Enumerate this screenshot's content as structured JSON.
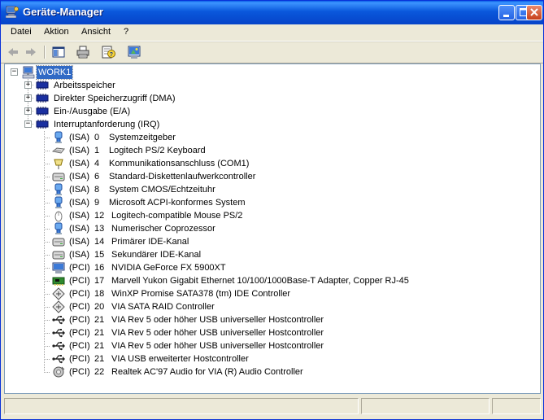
{
  "window": {
    "title": "Geräte-Manager"
  },
  "menu": [
    {
      "label": "Datei"
    },
    {
      "label": "Aktion"
    },
    {
      "label": "Ansicht"
    },
    {
      "label": "?"
    }
  ],
  "toolbar": {
    "back_icon": "back-arrow-icon",
    "forward_icon": "forward-arrow-icon",
    "show_hide_tree_icon": "console-tree-icon",
    "print_icon": "printer-icon",
    "help_icon": "help-properties-icon",
    "scan_icon": "scan-hardware-icon"
  },
  "tree": {
    "root": {
      "label": "WORK1",
      "expanded": true,
      "icon": "computer-icon"
    },
    "categories": [
      {
        "label": "Arbeitsspeicher",
        "expanded": false,
        "icon": "memory-chip-icon"
      },
      {
        "label": "Direkter Speicherzugriff (DMA)",
        "expanded": false,
        "icon": "memory-chip-icon"
      },
      {
        "label": "Ein-/Ausgabe (E/A)",
        "expanded": false,
        "icon": "memory-chip-icon"
      },
      {
        "label": "Interruptanforderung (IRQ)",
        "expanded": true,
        "icon": "memory-chip-icon"
      }
    ],
    "irq_items": [
      {
        "bus": "(ISA)",
        "irq": "0",
        "name": "Systemzeitgeber",
        "icon": "system-device-icon"
      },
      {
        "bus": "(ISA)",
        "irq": "1",
        "name": "Logitech PS/2 Keyboard",
        "icon": "keyboard-icon"
      },
      {
        "bus": "(ISA)",
        "irq": "4",
        "name": "Kommunikationsanschluss (COM1)",
        "icon": "port-icon"
      },
      {
        "bus": "(ISA)",
        "irq": "6",
        "name": "Standard-Diskettenlaufwerkcontroller",
        "icon": "disk-controller-icon"
      },
      {
        "bus": "(ISA)",
        "irq": "8",
        "name": "System CMOS/Echtzeituhr",
        "icon": "system-device-icon"
      },
      {
        "bus": "(ISA)",
        "irq": "9",
        "name": "Microsoft ACPI-konformes System",
        "icon": "system-device-icon"
      },
      {
        "bus": "(ISA)",
        "irq": "12",
        "name": "Logitech-compatible Mouse PS/2",
        "icon": "mouse-icon"
      },
      {
        "bus": "(ISA)",
        "irq": "13",
        "name": "Numerischer Coprozessor",
        "icon": "system-device-icon"
      },
      {
        "bus": "(ISA)",
        "irq": "14",
        "name": "Primärer IDE-Kanal",
        "icon": "disk-controller-icon"
      },
      {
        "bus": "(ISA)",
        "irq": "15",
        "name": "Sekundärer IDE-Kanal",
        "icon": "disk-controller-icon"
      },
      {
        "bus": "(PCI)",
        "irq": "16",
        "name": "NVIDIA GeForce FX 5900XT",
        "icon": "display-adapter-icon"
      },
      {
        "bus": "(PCI)",
        "irq": "17",
        "name": "Marvell Yukon Gigabit Ethernet 10/100/1000Base-T Adapter, Copper RJ-45",
        "icon": "network-adapter-icon"
      },
      {
        "bus": "(PCI)",
        "irq": "18",
        "name": "WinXP Promise SATA378 (tm) IDE Controller",
        "icon": "scsi-raid-icon"
      },
      {
        "bus": "(PCI)",
        "irq": "20",
        "name": "VIA SATA RAID Controller",
        "icon": "scsi-raid-icon"
      },
      {
        "bus": "(PCI)",
        "irq": "21",
        "name": "VIA Rev 5 oder höher USB universeller Hostcontroller",
        "icon": "usb-icon"
      },
      {
        "bus": "(PCI)",
        "irq": "21",
        "name": "VIA Rev 5 oder höher USB universeller Hostcontroller",
        "icon": "usb-icon"
      },
      {
        "bus": "(PCI)",
        "irq": "21",
        "name": "VIA Rev 5 oder höher USB universeller Hostcontroller",
        "icon": "usb-icon"
      },
      {
        "bus": "(PCI)",
        "irq": "21",
        "name": "VIA USB erweiterter Hostcontroller",
        "icon": "usb-icon"
      },
      {
        "bus": "(PCI)",
        "irq": "22",
        "name": "Realtek AC'97 Audio for VIA (R) Audio Controller",
        "icon": "audio-icon"
      }
    ]
  },
  "colors": {
    "titlebar": "#0a58dc",
    "selection": "#316ac5",
    "chrome": "#ece9d8"
  }
}
